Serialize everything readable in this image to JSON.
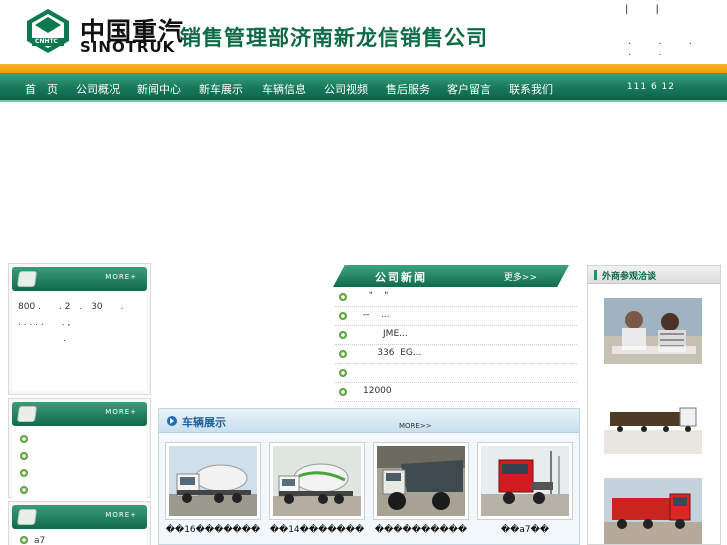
{
  "header": {
    "logo_badge_text": "CNHTC",
    "logo_cn": "中国重汽",
    "logo_en": "SINOTRUK",
    "company_name": "销售管理部济南新龙信销售公司",
    "top_bars": "| |",
    "top_dots": ". . . . ."
  },
  "nav": {
    "items": [
      {
        "label": "首　页"
      },
      {
        "label": "公司概况"
      },
      {
        "label": "新闻中心"
      },
      {
        "label": "新车展示"
      },
      {
        "label": "车辆信息"
      },
      {
        "label": "公司视频"
      },
      {
        "label": "售后服务"
      },
      {
        "label": "客户留言"
      },
      {
        "label": "联系我们"
      }
    ],
    "right_text": "111 6 12"
  },
  "left": {
    "box1": {
      "more": "MORE+",
      "lines": [
        "800 .　　. 2　.　30　　.",
        ". . . . .　　. ,",
        "　　　　　."
      ]
    },
    "box2": {
      "more": "MORE+",
      "items": [
        "",
        "",
        "",
        ""
      ]
    },
    "box3": {
      "more": "MORE+",
      "items": [
        "a7"
      ]
    }
  },
  "news": {
    "title": "公司新闻",
    "more": "更多>>",
    "rows": [
      "  \"    \"",
      "--    ...",
      "       JME...",
      "     336  EG...",
      "",
      "12000"
    ]
  },
  "vehicles": {
    "title": "车辆展示",
    "more": "MORE>>",
    "items": [
      {
        "caption": "��16�������"
      },
      {
        "caption": "��14�������"
      },
      {
        "caption": "����������"
      },
      {
        "caption": "��a7��"
      }
    ]
  },
  "right": {
    "title": "外商参观洽谈"
  },
  "colors": {
    "brand_green": "#0c6a45",
    "orange_band": "#f19b0e",
    "nav_green": "#16795a"
  }
}
